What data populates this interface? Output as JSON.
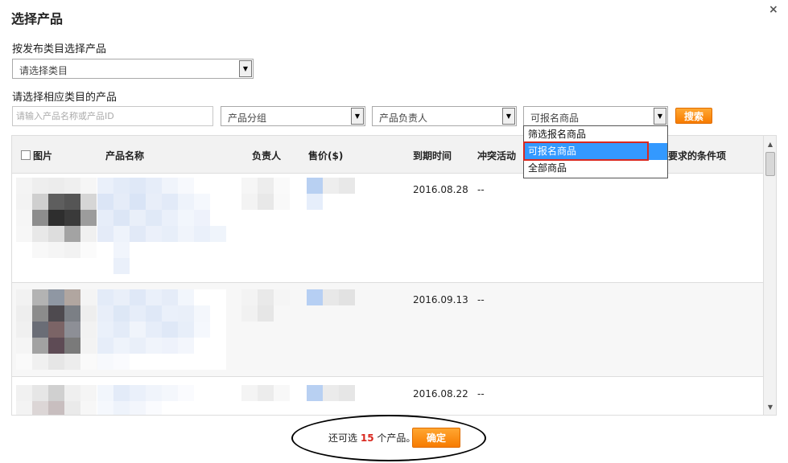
{
  "dialog": {
    "title": "选择产品",
    "close_glyph": "×"
  },
  "section1": {
    "label": "按发布类目选择产品",
    "category_select": "请选择类目"
  },
  "section2": {
    "label": "请选择相应类目的产品"
  },
  "filters": {
    "search_placeholder": "请输入产品名称或产品ID",
    "group_select": "产品分组",
    "owner_select": "产品负责人",
    "status_select": "可报名商品",
    "search_button": "搜索"
  },
  "dropdown": {
    "options": [
      "筛选报名商品",
      "可报名商品",
      "全部商品"
    ],
    "selected_index": 1
  },
  "table": {
    "headers": {
      "image": "图片",
      "name": "产品名称",
      "owner": "负责人",
      "price": "售价($)",
      "expiry": "到期时间",
      "conflict": "冲突活动",
      "criteria": "合要求的条件项"
    },
    "rows": [
      {
        "expiry": "2016.08.28",
        "conflict": "--"
      },
      {
        "expiry": "2016.09.13",
        "conflict": "--"
      },
      {
        "expiry": "2016.08.22",
        "conflict": "--"
      }
    ]
  },
  "footer": {
    "prefix": "还可选",
    "count": "15",
    "suffix": "个产品。",
    "confirm_button": "确定"
  },
  "colors": {
    "accent": "#f77b00",
    "highlight": "#d9281f",
    "selected": "#3399ff"
  }
}
